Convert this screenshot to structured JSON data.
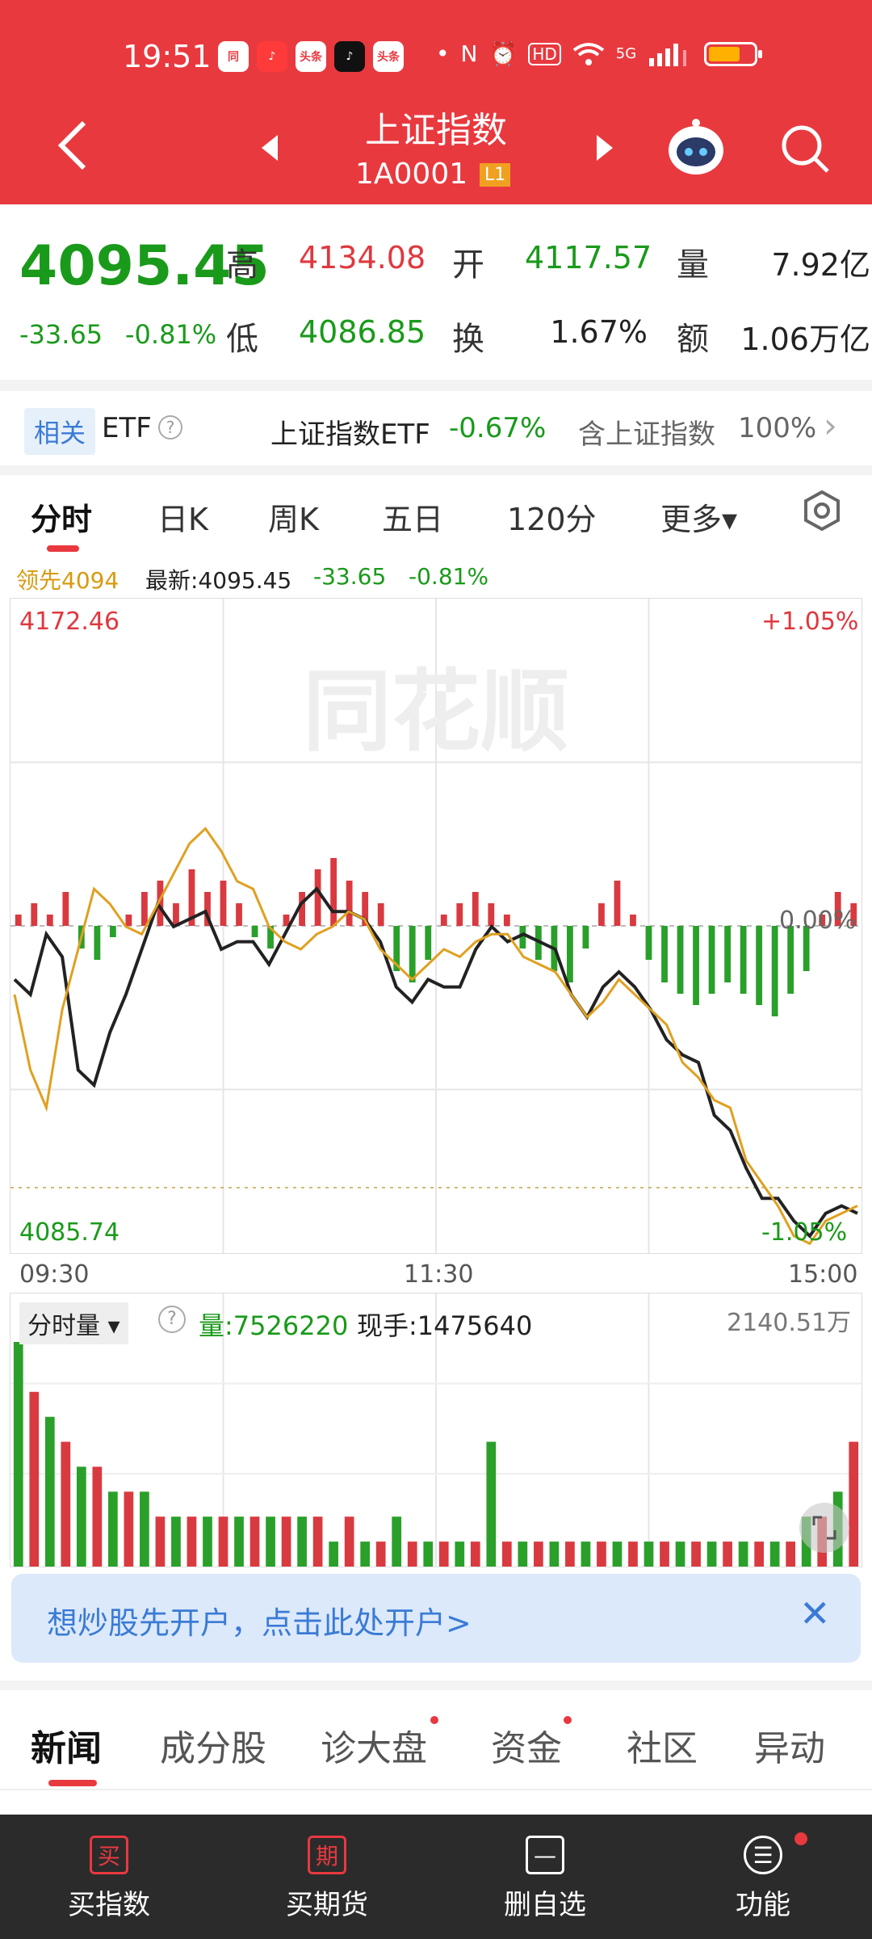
{
  "status": {
    "time": "19:51",
    "app_icons": [
      "同",
      "♪",
      "头条",
      "♪",
      "头条"
    ],
    "hd": "HD",
    "signal": "5G"
  },
  "header": {
    "title": "上证指数",
    "code": "1A0001",
    "level": "L1"
  },
  "quote": {
    "price": "4095.45",
    "change": "-33.65",
    "change_pct": "-0.81%",
    "high_label": "高",
    "high": "4134.08",
    "open_label": "开",
    "open": "4117.57",
    "volume_label": "量",
    "volume": "7.92亿",
    "low_label": "低",
    "low": "4086.85",
    "turnover_label": "换",
    "turnover": "1.67%",
    "amount_label": "额",
    "amount": "1.06万亿"
  },
  "etf": {
    "tag": "相关",
    "label": "ETF",
    "help": "?",
    "name": "上证指数ETF",
    "pct": "-0.67%",
    "desc": "含上证指数",
    "weight": "100%",
    "arrow": "›"
  },
  "tabs": [
    {
      "label": "分时"
    },
    {
      "label": "日K"
    },
    {
      "label": "周K"
    },
    {
      "label": "五日"
    },
    {
      "label": "120分"
    },
    {
      "label": "更多▾"
    }
  ],
  "chart_info": {
    "lead": "领先4094",
    "latest": "最新:4095.45",
    "chg": "-33.65",
    "pct": "-0.81%"
  },
  "chart_data": {
    "type": "line",
    "title": "",
    "y_top": "4172.46",
    "y_bottom": "4085.74",
    "pct_top": "+1.05%",
    "pct_bottom": "-1.05%",
    "pct_mid": "0.00%",
    "x_labels": [
      "09:30",
      "11:30",
      "15:00"
    ],
    "ylim": [
      4085.74,
      4172.46
    ],
    "series": [
      {
        "values": [
          4122,
          4120,
          4128,
          4125,
          4110,
          4108,
          4115,
          4120,
          4126,
          4132,
          4129,
          4130,
          4131,
          4126,
          4127,
          4127,
          4124,
          4128,
          4132,
          4134,
          4131,
          4131,
          4130,
          4127,
          4121,
          4119,
          4122,
          4121,
          4121,
          4126,
          4129,
          4127,
          4128,
          4127,
          4126,
          4120,
          4117,
          4121,
          4123,
          4121,
          4118,
          4114,
          4112,
          4111,
          4104,
          4102,
          4097,
          4093,
          4093,
          4090,
          4088,
          4091,
          4092,
          4091
        ],
        "color": "#222222"
      },
      {
        "values": [
          4120,
          4110,
          4105,
          4118,
          4126,
          4134,
          4132,
          4129,
          4128,
          4132,
          4136,
          4140,
          4142,
          4139,
          4135,
          4134,
          4129,
          4127,
          4126,
          4128,
          4129,
          4131,
          4130,
          4126,
          4124,
          4122,
          4124,
          4126,
          4125,
          4127,
          4128,
          4128,
          4125,
          4124,
          4123,
          4120,
          4117,
          4119,
          4122,
          4120,
          4118,
          4116,
          4111,
          4109,
          4106,
          4105,
          4098,
          4095,
          4092,
          4088,
          4087,
          4090,
          4091,
          4092
        ],
        "color": "#e0a020"
      }
    ],
    "bars": [
      1,
      2,
      1,
      3,
      -2,
      -3,
      -1,
      1,
      3,
      4,
      2,
      5,
      3,
      4,
      2,
      -1,
      -2,
      1,
      3,
      5,
      6,
      4,
      3,
      2,
      -4,
      -5,
      -3,
      1,
      2,
      3,
      2,
      1,
      -2,
      -3,
      -4,
      -5,
      -2,
      2,
      4,
      1,
      -3,
      -5,
      -6,
      -7,
      -6,
      -5,
      -6,
      -7,
      -8,
      -6,
      -4,
      1,
      3,
      2
    ]
  },
  "volume": {
    "label": "分时量",
    "help": "?",
    "vol": "量:7526220",
    "hand": "现手:1475640",
    "max": "2140.51万",
    "values": [
      9,
      7,
      6,
      5,
      4,
      4,
      3,
      3,
      3,
      2,
      2,
      2,
      2,
      2,
      2,
      2,
      2,
      2,
      2,
      2,
      1,
      2,
      1,
      1,
      2,
      1,
      1,
      1,
      1,
      1,
      5,
      1,
      1,
      1,
      1,
      1,
      1,
      1,
      1,
      1,
      1,
      1,
      1,
      1,
      1,
      1,
      1,
      1,
      1,
      1,
      2,
      2,
      3,
      5
    ]
  },
  "banner": {
    "text": "想炒股先开户，点击此处开户>",
    "close": "✕"
  },
  "news_tabs": [
    {
      "label": "新闻"
    },
    {
      "label": "成分股"
    },
    {
      "label": "诊大盘"
    },
    {
      "label": "资金"
    },
    {
      "label": "社区"
    },
    {
      "label": "异动"
    }
  ],
  "bottom_nav": [
    {
      "icon": "买",
      "label": "买指数"
    },
    {
      "icon": "期",
      "label": "买期货"
    },
    {
      "icon": "—",
      "label": "删自选"
    },
    {
      "icon": "☰",
      "label": "功能"
    }
  ],
  "watermark": "同花顺"
}
